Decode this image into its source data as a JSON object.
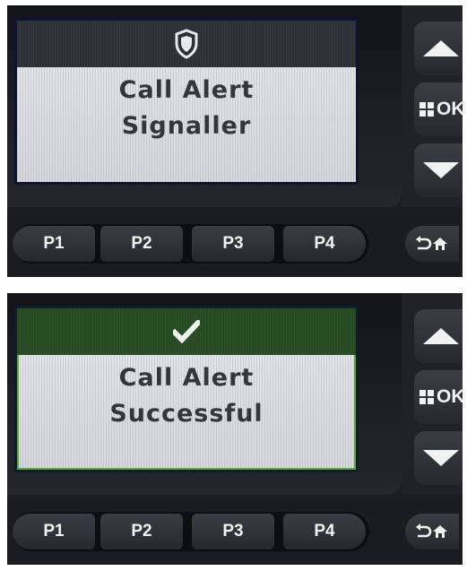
{
  "panels": [
    {
      "state": "in-progress",
      "status_icon": "shield-icon",
      "line1": "Call Alert",
      "line2": "Signaller"
    },
    {
      "state": "success",
      "status_icon": "checkmark-icon",
      "line1": "Call Alert",
      "line2": "Successful"
    }
  ],
  "buttons": {
    "up": "up-arrow-icon",
    "ok": "OK",
    "down": "down-arrow-icon",
    "programmable": [
      "P1",
      "P2",
      "P3",
      "P4"
    ],
    "back_home": "back-home-icon"
  },
  "colors": {
    "lcd_background": "#dfe2e5",
    "lcd_text": "#33363a",
    "header_bar_top": "#2b2f36",
    "header_bar_bottom": "#254a22",
    "success_border": "#5ea83c",
    "button_label": "#f2f2f2"
  }
}
